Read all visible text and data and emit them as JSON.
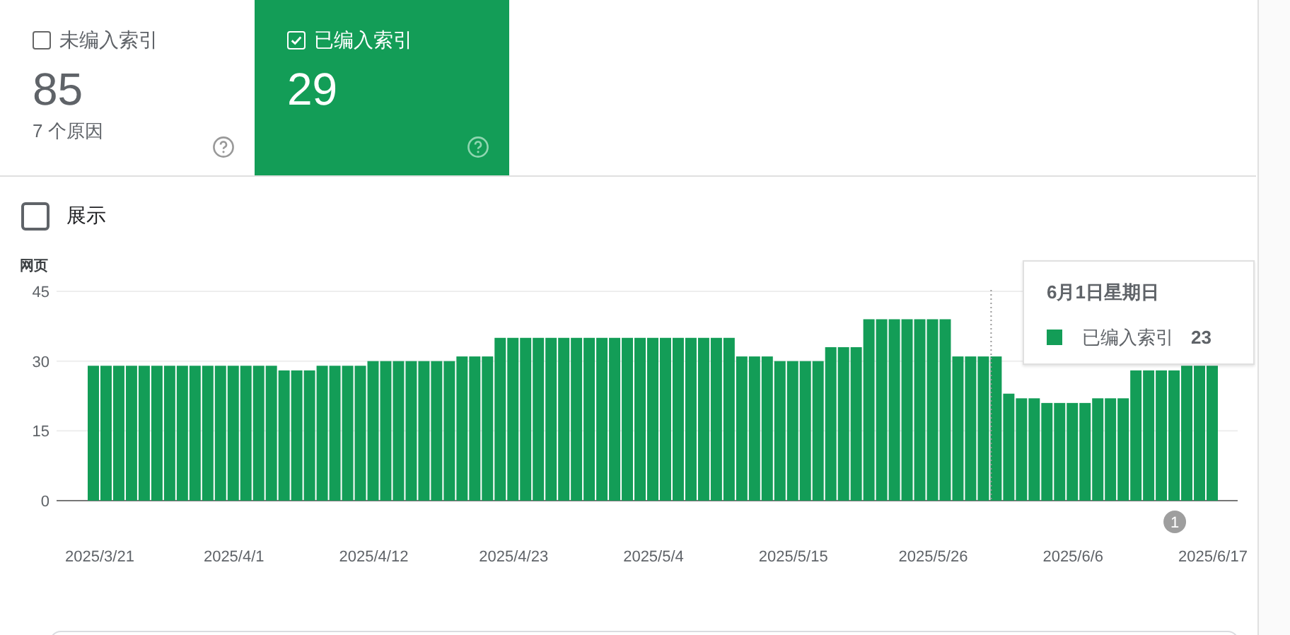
{
  "summary_tabs": [
    {
      "label": "未编入索引",
      "value": "85",
      "note": "7 个原因",
      "selected": false
    },
    {
      "label": "已编入索引",
      "value": "29",
      "selected": true
    }
  ],
  "toggle": {
    "label": "展示",
    "checked": false
  },
  "chart": {
    "chart_data": {
      "type": "bar",
      "ylabel": "网页",
      "categories": [
        "2025/3/21",
        null,
        null,
        null,
        null,
        null,
        null,
        null,
        null,
        null,
        null,
        "2025/4/1",
        null,
        null,
        null,
        null,
        null,
        null,
        null,
        null,
        null,
        null,
        "2025/4/12",
        null,
        null,
        null,
        null,
        null,
        null,
        null,
        null,
        null,
        null,
        "2025/4/23",
        null,
        null,
        null,
        null,
        null,
        null,
        null,
        null,
        null,
        null,
        "2025/5/4",
        null,
        null,
        null,
        null,
        null,
        null,
        null,
        null,
        null,
        null,
        "2025/5/15",
        null,
        null,
        null,
        null,
        null,
        null,
        null,
        null,
        null,
        null,
        "2025/5/26",
        null,
        null,
        null,
        null,
        null,
        null,
        null,
        null,
        null,
        null,
        "2025/6/6",
        null,
        null,
        null,
        null,
        null,
        null,
        null,
        null,
        null,
        null,
        "2025/6/17"
      ],
      "series": [
        {
          "name": "已编入索引",
          "color": "#139d57",
          "values": [
            29,
            29,
            29,
            29,
            29,
            29,
            29,
            29,
            29,
            29,
            29,
            29,
            29,
            29,
            29,
            28,
            28,
            28,
            29,
            29,
            29,
            29,
            30,
            30,
            30,
            30,
            30,
            30,
            30,
            31,
            31,
            31,
            35,
            35,
            35,
            35,
            35,
            35,
            35,
            35,
            35,
            35,
            35,
            35,
            35,
            35,
            35,
            35,
            35,
            35,
            35,
            31,
            31,
            31,
            30,
            30,
            30,
            30,
            33,
            33,
            33,
            39,
            39,
            39,
            39,
            39,
            39,
            39,
            31,
            31,
            31,
            31,
            23,
            22,
            22,
            21,
            21,
            21,
            21,
            22,
            22,
            22,
            28,
            28,
            28,
            28,
            29,
            29,
            29
          ]
        }
      ],
      "ylim": [
        0,
        45
      ],
      "yticks": [
        0,
        15,
        30,
        45
      ],
      "annotations": [
        "1"
      ]
    }
  },
  "tooltip": {
    "title": "6月1日星期日",
    "value": "23"
  }
}
